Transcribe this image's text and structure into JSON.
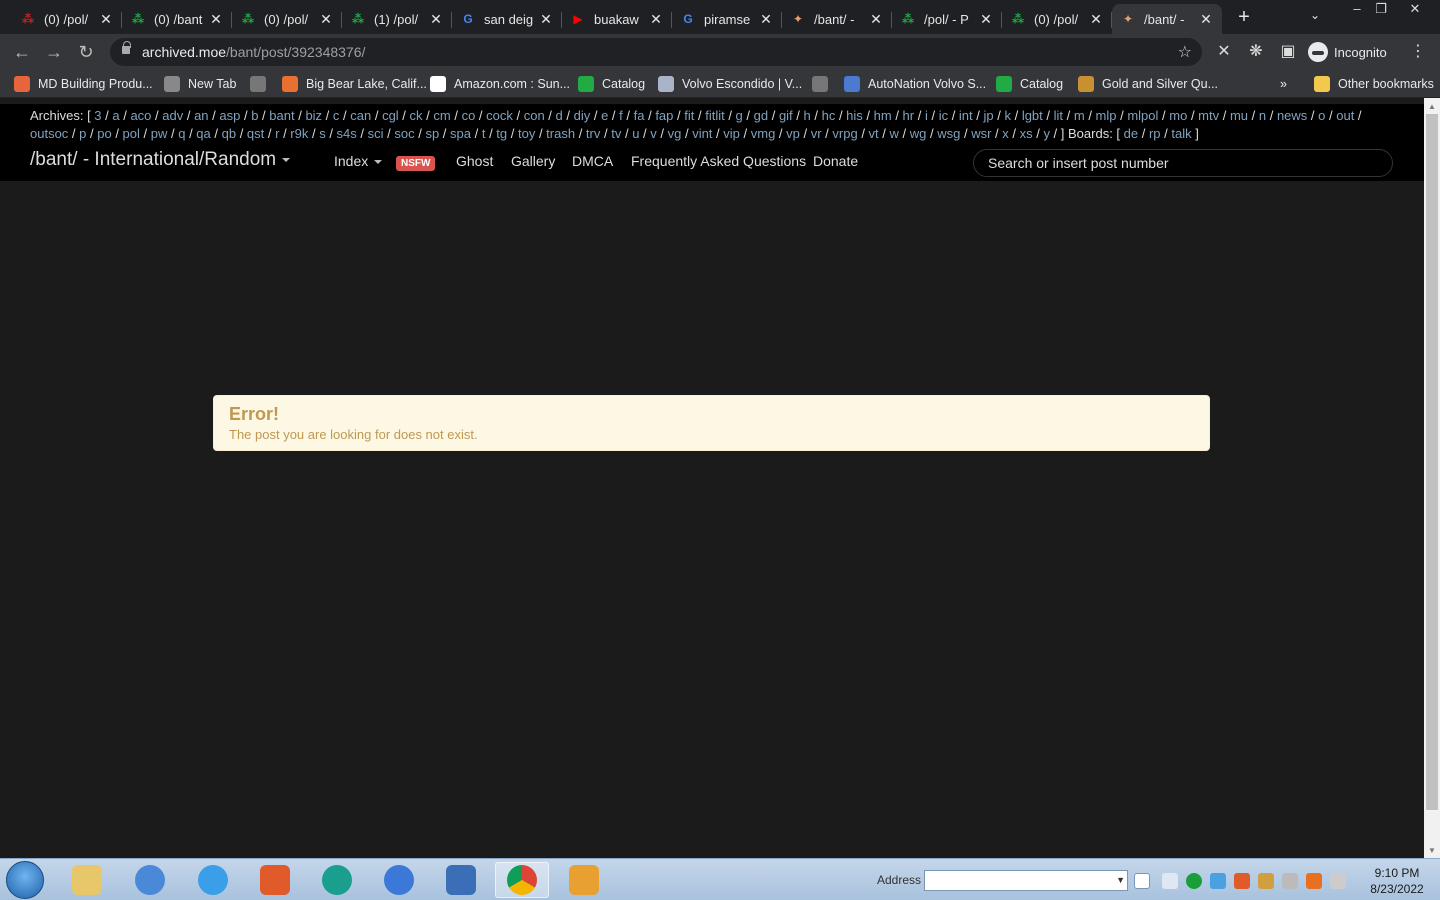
{
  "browser": {
    "tabs": [
      {
        "label": "(0) /pol/",
        "icon": "catalog-icon",
        "color": "#cc2222"
      },
      {
        "label": "(0) /bant",
        "icon": "catalog-icon",
        "color": "#22aa44"
      },
      {
        "label": "(0) /pol/",
        "icon": "catalog-icon",
        "color": "#22aa44"
      },
      {
        "label": "(1) /pol/",
        "icon": "catalog-icon",
        "color": "#22aa44"
      },
      {
        "label": "san deig",
        "icon": "google-icon",
        "color": "#4285f4"
      },
      {
        "label": "buakaw",
        "icon": "youtube-icon",
        "color": "#ff0000"
      },
      {
        "label": "piramse",
        "icon": "google-icon",
        "color": "#4285f4"
      },
      {
        "label": "/bant/ -",
        "icon": "archive-icon",
        "color": "#e8a070"
      },
      {
        "label": "/pol/ - P",
        "icon": "catalog-icon",
        "color": "#22aa44"
      },
      {
        "label": "(0) /pol/",
        "icon": "catalog-icon",
        "color": "#22aa44"
      },
      {
        "label": "/bant/ -",
        "icon": "archive-icon",
        "color": "#e8a070",
        "active": true
      }
    ],
    "url_host": "archived.moe",
    "url_path": "/bant/post/392348376/",
    "profile_label": "Incognito",
    "bookmarks": [
      {
        "label": "MD Building Produ...",
        "color": "#e8643c"
      },
      {
        "label": "New Tab",
        "color": "#888888"
      },
      {
        "label": "",
        "color": "#777777"
      },
      {
        "label": "Big Bear Lake, Calif...",
        "color": "#e87030"
      },
      {
        "label": "Amazon.com : Sun...",
        "color": "#ffffff"
      },
      {
        "label": "Catalog",
        "color": "#22aa44"
      },
      {
        "label": "Volvo Escondido | V...",
        "color": "#aab4c8"
      },
      {
        "label": "",
        "color": "#777777"
      },
      {
        "label": "AutoNation Volvo S...",
        "color": "#4a7bd0"
      },
      {
        "label": "Catalog",
        "color": "#22aa44"
      },
      {
        "label": "Gold and Silver Qu...",
        "color": "#c89030"
      }
    ],
    "bookmarks_more": "»",
    "other_bookmarks": "Other bookmarks"
  },
  "site": {
    "archives_label": "Archives: [",
    "archives": [
      "3",
      "a",
      "aco",
      "adv",
      "an",
      "asp",
      "b",
      "bant",
      "biz",
      "c",
      "can",
      "cgl",
      "ck",
      "cm",
      "co",
      "cock",
      "con",
      "d",
      "diy",
      "e",
      "f",
      "fa",
      "fap",
      "fit",
      "fitlit",
      "g",
      "gd",
      "gif",
      "h",
      "hc",
      "his",
      "hm",
      "hr",
      "i",
      "ic",
      "int",
      "jp",
      "k",
      "lgbt",
      "lit",
      "m",
      "mlp",
      "mlpol",
      "mo",
      "mtv",
      "mu",
      "n",
      "news",
      "o",
      "out",
      "outsoc",
      "p",
      "po",
      "pol",
      "pw",
      "q",
      "qa",
      "qb",
      "qst",
      "r",
      "r9k",
      "s",
      "s4s",
      "sci",
      "soc",
      "sp",
      "spa",
      "t",
      "tg",
      "toy",
      "trash",
      "trv",
      "tv",
      "u",
      "v",
      "vg",
      "vint",
      "vip",
      "vmg",
      "vp",
      "vr",
      "vrpg",
      "vt",
      "w",
      "wg",
      "wsg",
      "wsr",
      "x",
      "xs",
      "y"
    ],
    "boards_label": "] Boards: [",
    "boards": [
      "de",
      "rp",
      "talk"
    ],
    "boards_close": "]",
    "board_title": "/bant/ - International/Random",
    "nav": {
      "index": "Index",
      "nsfw": "NSFW",
      "ghost": "Ghost",
      "gallery": "Gallery",
      "dmca": "DMCA",
      "faq": "Frequently Asked Questions",
      "donate": "Donate"
    },
    "search_placeholder": "Search or insert post number"
  },
  "error": {
    "heading": "Error!",
    "message": "The post you are looking for does not exist."
  },
  "taskbar": {
    "address_label": "Address",
    "time": "9:10 PM",
    "date": "8/23/2022"
  }
}
